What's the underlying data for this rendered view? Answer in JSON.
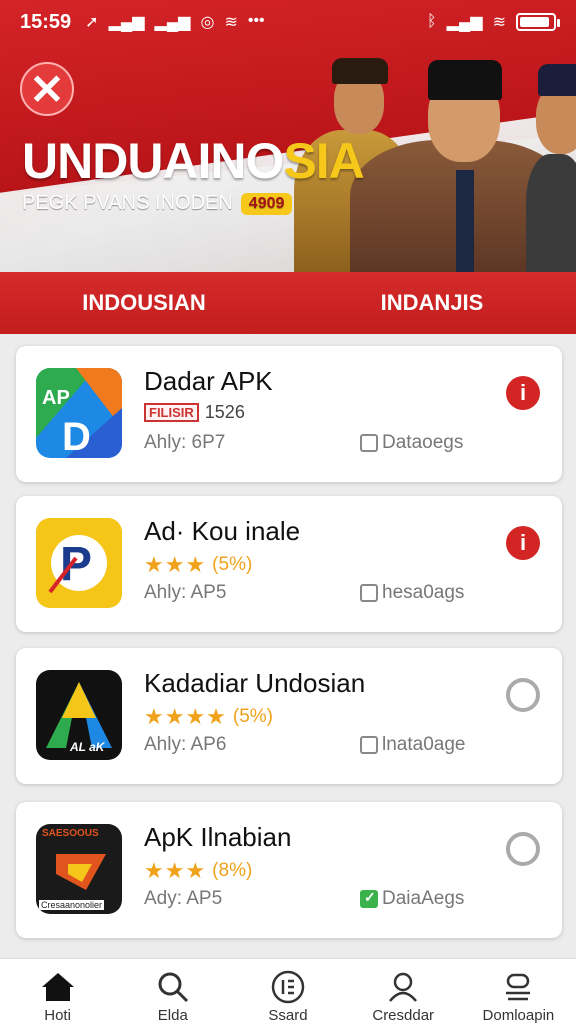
{
  "status_bar": {
    "time": "15:59",
    "battery_level": 0.9
  },
  "hero": {
    "title_part1": "UNDUAINO",
    "title_part2": "SIA",
    "subtitle": "PEGK PVANS INODEN",
    "badge": "4909"
  },
  "tabs": [
    {
      "label": "INDOUSIAN"
    },
    {
      "label": "INDANJIS"
    }
  ],
  "apps": [
    {
      "name": "Dadar APK",
      "tag": "FILISIR",
      "meta": "1526",
      "size": "Ahly: 6P7",
      "data": "Dataoegs",
      "action": "info",
      "icon": "dadar-apk-icon"
    },
    {
      "name": "Ad· Kou inale",
      "stars": "★★★",
      "rating": "(5%)",
      "size": "Ahly: AP5",
      "data": "hesa0ags",
      "action": "info",
      "icon": "ad-kou-icon"
    },
    {
      "name": "Kadadiar Undosian",
      "stars": "★★★★",
      "rating": "(5%)",
      "size": "Ahly: AP6",
      "data": "lnata0age",
      "action": "circle",
      "icon": "kadadiar-icon",
      "icon_text": "AL aK"
    },
    {
      "name": "ApK Ilnabian",
      "stars": "★★★",
      "rating": "(8%)",
      "size": "Ady: AP5",
      "data": "DaiaAegs",
      "action": "circle",
      "icon": "apk-ilnabian-icon",
      "icon_text_top": "SAESOOUS",
      "icon_text_bottom": "Cresaanonolier"
    }
  ],
  "bottom_nav": [
    {
      "label": "Hoti",
      "icon": "home-icon"
    },
    {
      "label": "Elda",
      "icon": "search-icon"
    },
    {
      "label": "Ssard",
      "icon": "list-icon"
    },
    {
      "label": "Cresddar",
      "icon": "user-icon"
    },
    {
      "label": "Domloapin",
      "icon": "download-icon"
    }
  ],
  "colors": {
    "brand_red": "#d42b2b",
    "accent_yellow": "#f6c81a",
    "star": "#f0a21b"
  }
}
